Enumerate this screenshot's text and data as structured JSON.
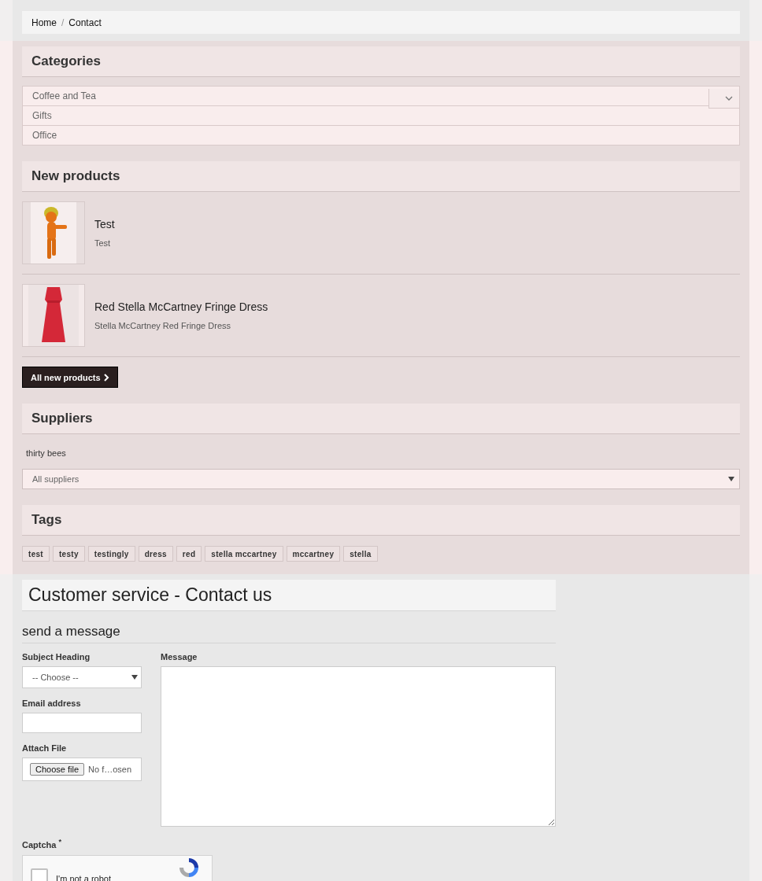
{
  "breadcrumb": {
    "separator": "/",
    "items": [
      {
        "label": "Home"
      },
      {
        "label": "Contact"
      }
    ]
  },
  "categories": {
    "title": "Categories",
    "items": [
      {
        "label": "Coffee and Tea",
        "expandable": true
      },
      {
        "label": "Gifts",
        "expandable": false
      },
      {
        "label": "Office",
        "expandable": false
      }
    ]
  },
  "new_products": {
    "title": "New products",
    "items": [
      {
        "name": "Test",
        "description": "Test"
      },
      {
        "name": "Red Stella McCartney Fringe Dress",
        "description": "Stella McCartney Red Fringe Dress"
      }
    ],
    "button": "All new products"
  },
  "suppliers": {
    "title": "Suppliers",
    "items": [
      "thirty bees"
    ],
    "select": "All suppliers"
  },
  "tags": {
    "title": "Tags",
    "items": [
      "test",
      "testy",
      "testingly",
      "dress",
      "red",
      "stella mccartney",
      "mccartney",
      "stella"
    ]
  },
  "contact": {
    "title": "Customer service - Contact us",
    "subtitle": "send a message",
    "subject": {
      "label": "Subject Heading",
      "value": "-- Choose --"
    },
    "email": {
      "label": "Email address"
    },
    "attach": {
      "label": "Attach File",
      "button": "Choose file",
      "status": "No f…osen"
    },
    "message": {
      "label": "Message"
    },
    "captcha": {
      "label": "Captcha $^{*}$",
      "text": "I'm not a robot",
      "checked": false
    }
  }
}
